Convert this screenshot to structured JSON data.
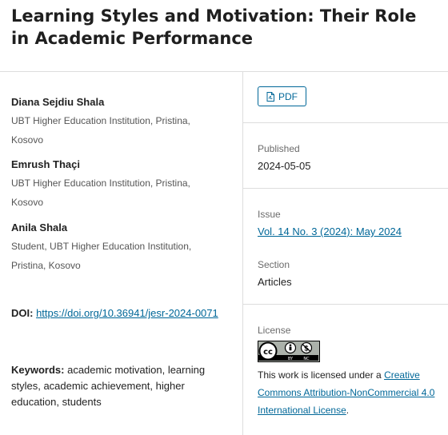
{
  "article": {
    "title": "Learning Styles and Motivation: Their Role in Academic Performance"
  },
  "authors": [
    {
      "name": "Diana Sejdiu Shala",
      "affiliation": "UBT Higher Education Institution, Pristina, Kosovo"
    },
    {
      "name": "Emrush Thaçi",
      "affiliation": "UBT Higher Education Institution, Pristina, Kosovo"
    },
    {
      "name": "Anila Shala",
      "affiliation": "Student, UBT Higher Education Institution, Pristina, Kosovo"
    }
  ],
  "doi": {
    "label": "DOI:",
    "link": "https://doi.org/10.36941/jesr-2024-0071"
  },
  "keywords": {
    "label": "Keywords:",
    "value": "academic motivation, learning styles, academic achievement, higher education, students"
  },
  "galley": {
    "pdf_label": "PDF",
    "pdf_icon": "file-icon"
  },
  "published": {
    "label": "Published",
    "value": "2024-05-05"
  },
  "issue": {
    "label": "Issue",
    "link": "Vol. 14 No. 3 (2024): May 2024"
  },
  "section": {
    "label": "Section",
    "value": "Articles"
  },
  "license": {
    "label": "License",
    "badge_icon": "cc-by-nc-badge",
    "badge_text_by": "BY",
    "badge_text_nc": "NC",
    "text_prefix": "This work is licensed under a",
    "link": "Creative Commons Attribution-NonCommercial 4.0 International License",
    "text_suffix": "."
  },
  "colors": {
    "link": "#006798",
    "divider": "#dddddd"
  }
}
